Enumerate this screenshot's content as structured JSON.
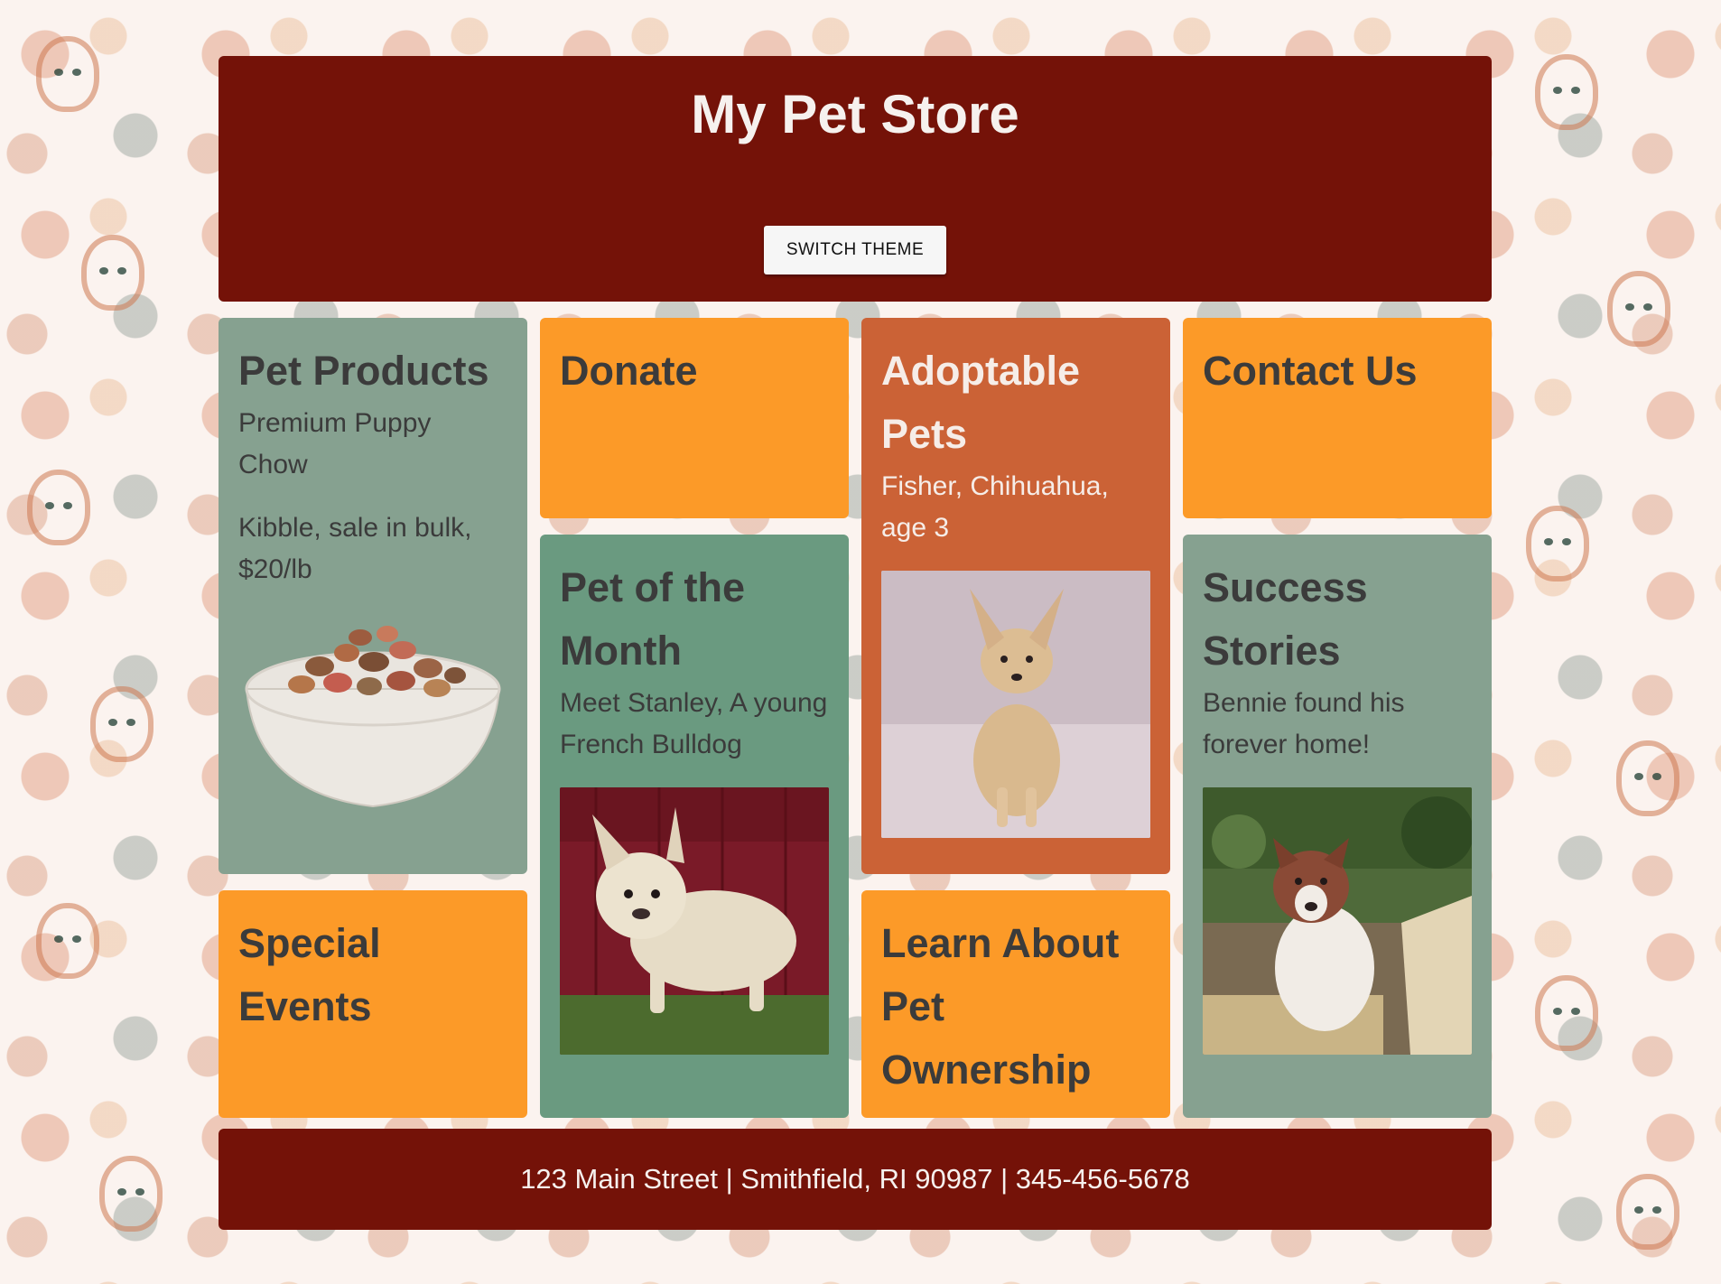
{
  "header": {
    "title": "My Pet Store",
    "switch_theme_label": "SWITCH THEME"
  },
  "cards": {
    "pet_products": {
      "title": "Pet Products",
      "line1": "Premium Puppy Chow",
      "line2": "Kibble, sale in bulk, $20/lb"
    },
    "donate": {
      "title": "Donate"
    },
    "adoptable": {
      "title": "Adoptable Pets",
      "line1": "Fisher, Chihuahua, age 3"
    },
    "contact": {
      "title": "Contact Us"
    },
    "pet_of_month": {
      "title": "Pet of the Month",
      "line1": "Meet Stanley, A young French Bulldog"
    },
    "success": {
      "title": "Success Stories",
      "line1": "Bennie found his forever home!"
    },
    "events": {
      "title": "Special Events"
    },
    "learn": {
      "title": "Learn About Pet Ownership"
    }
  },
  "footer": {
    "address": "123 Main Street | Smithfield, RI 90987 | 345-456-5678"
  },
  "colors": {
    "header_bg": "#741208",
    "orange": "#fc9a28",
    "sage": "#86a190",
    "green": "#6a9a80",
    "rust": "#cb6236"
  }
}
